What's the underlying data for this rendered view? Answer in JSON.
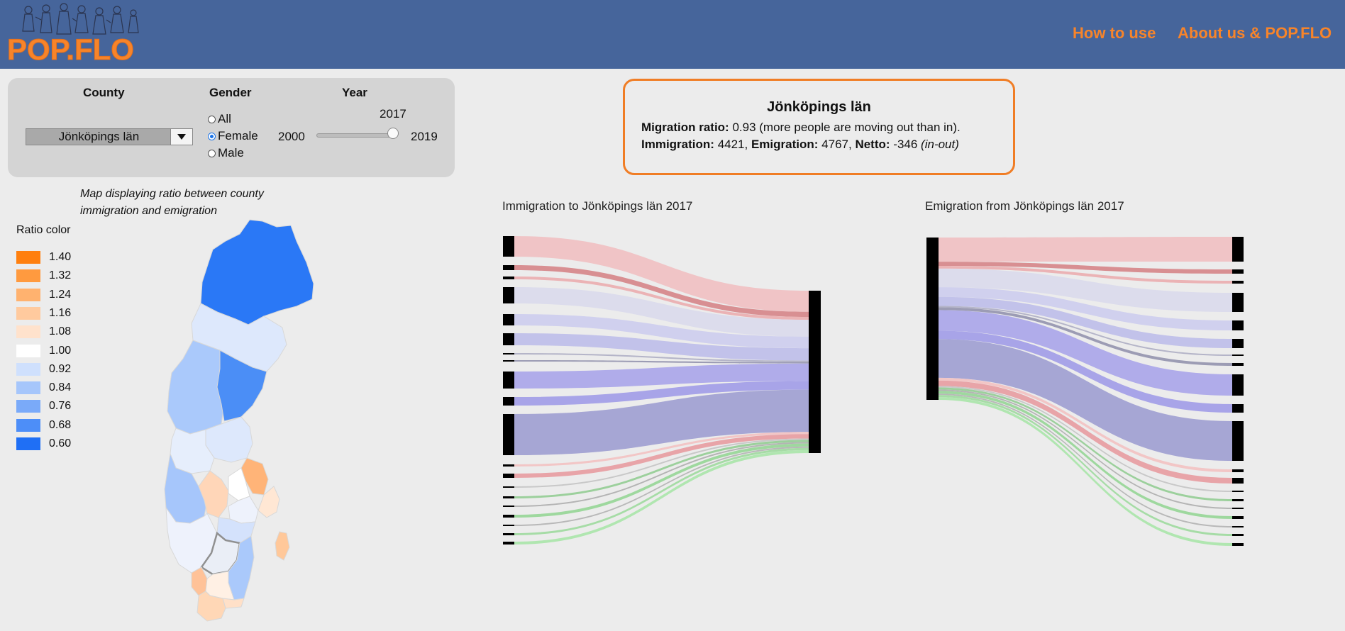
{
  "header": {
    "brand": "POP.FLO",
    "nav": [
      {
        "label": "How to use"
      },
      {
        "label": "About us & POP.FLO"
      }
    ],
    "colors": {
      "bg": "#46659b",
      "accent": "#f7842a"
    }
  },
  "controls": {
    "county_label": "County",
    "county_value": "Jönköpings län",
    "gender_label": "Gender",
    "gender_options": [
      "All",
      "Female",
      "Male"
    ],
    "gender_selected": "Female",
    "year_label": "Year",
    "year_min": "2000",
    "year_max": "2019",
    "year_value": "2017"
  },
  "info": {
    "title": "Jönköpings län",
    "ratio_label": "Migration ratio:",
    "ratio_text": "0.93 (more people are moving out than in).",
    "immigration_label": "Immigration:",
    "immigration_value": "4421,",
    "emigration_label": "Emigration:",
    "emigration_value": "4767,",
    "netto_label": "Netto:",
    "netto_value": "-346",
    "netto_note": "(in-out)"
  },
  "map": {
    "caption_line1": "Map displaying ratio between county",
    "caption_line2": "immigration and emigration",
    "legend_title": "Ratio color",
    "legend": [
      {
        "label": "1.40",
        "color": "#ff7f0e"
      },
      {
        "label": "1.32",
        "color": "#ff9a3f"
      },
      {
        "label": "1.24",
        "color": "#ffb26f"
      },
      {
        "label": "1.16",
        "color": "#ffca9e"
      },
      {
        "label": "1.08",
        "color": "#ffe2cc"
      },
      {
        "label": "1.00",
        "color": "#ffffff"
      },
      {
        "label": "0.92",
        "color": "#cfe0fd"
      },
      {
        "label": "0.84",
        "color": "#a6c6fb"
      },
      {
        "label": "0.76",
        "color": "#7aaaf9"
      },
      {
        "label": "0.68",
        "color": "#4d8ef8"
      },
      {
        "label": "0.60",
        "color": "#1f6ff5"
      }
    ]
  },
  "sankey": {
    "immigration_title": "Immigration to Jönköpings län 2017",
    "emigration_title": "Emigration from Jönköpings län 2017"
  }
}
